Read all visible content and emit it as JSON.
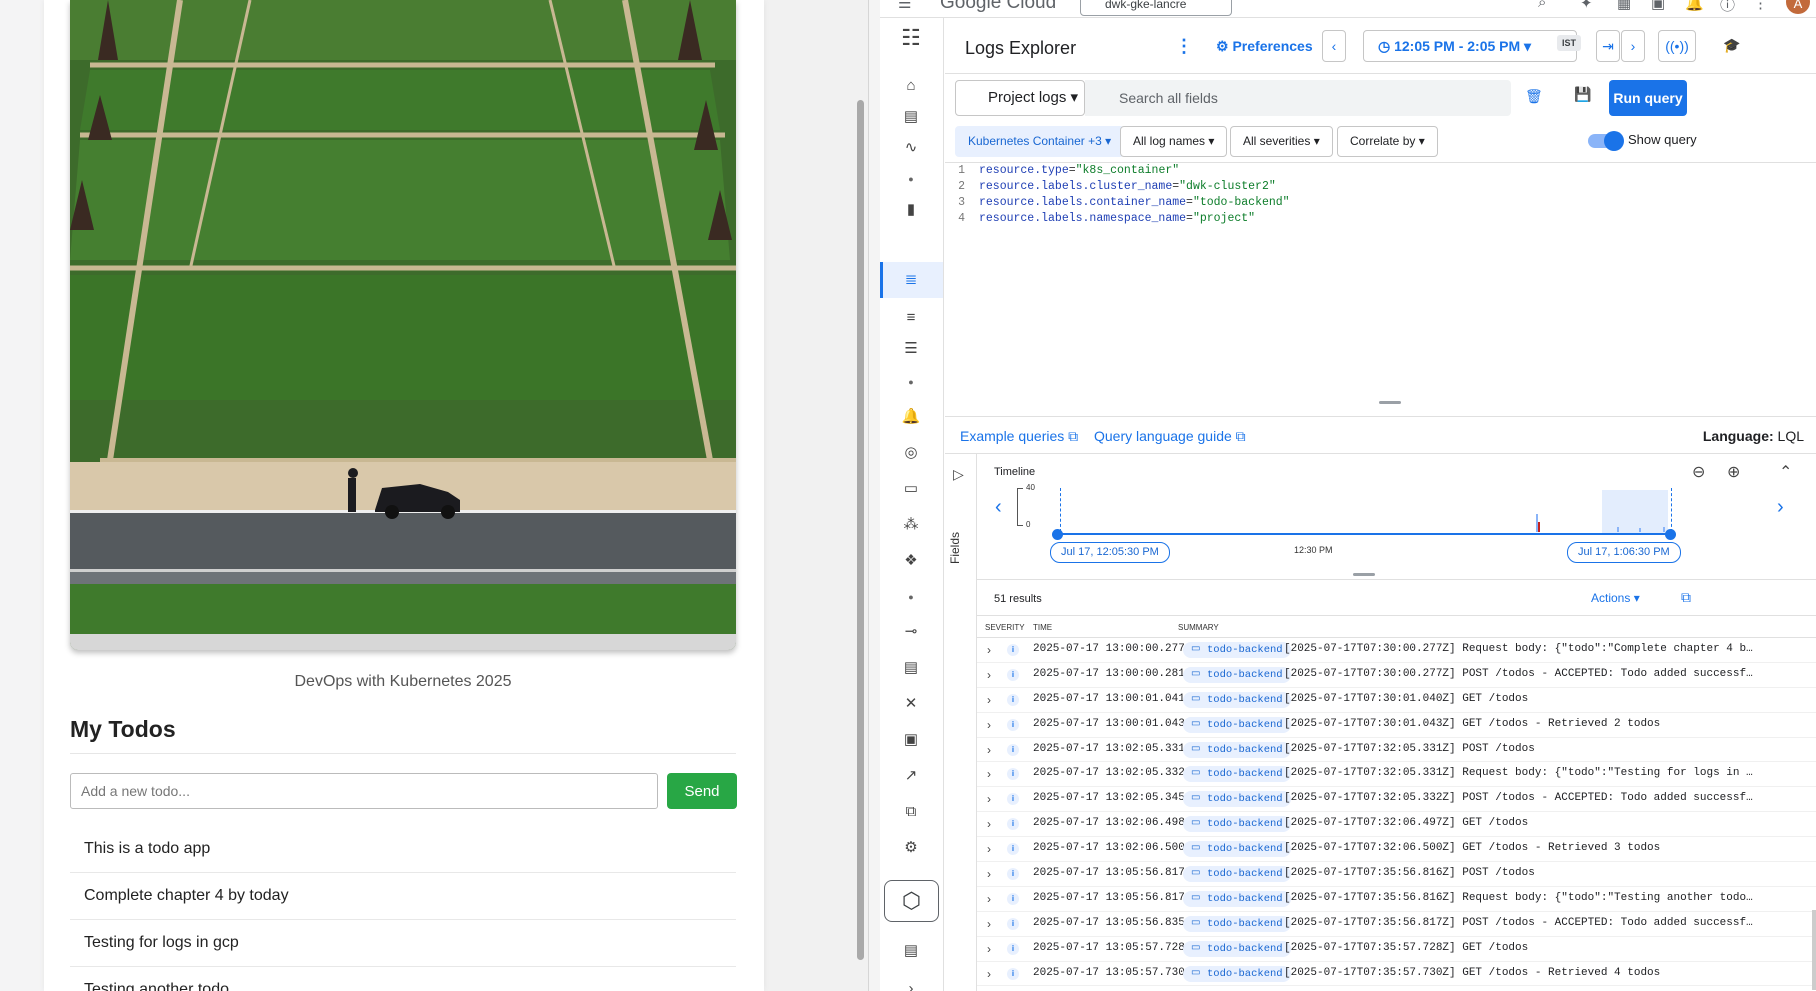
{
  "left_app": {
    "caption": "DevOps with Kubernetes 2025",
    "title": "My Todos",
    "input_placeholder": "Add a new todo...",
    "send_label": "Send",
    "todos": [
      "This is a todo app",
      "Complete chapter 4 by today",
      "Testing for logs in gcp",
      "Testing another todo"
    ]
  },
  "gcp": {
    "brand": "Google Cloud",
    "project": "dwk-gke-lancre",
    "avatar": "A",
    "page_title": "Logs Explorer",
    "preferences": "Preferences",
    "time_range": "12:05 PM - 2:05 PM",
    "timezone": "IST",
    "source_button": "Project logs",
    "search_placeholder": "Search all fields",
    "run_query": "Run query",
    "chips": [
      "Kubernetes Container +3",
      "All log names",
      "All severities",
      "Correlate by"
    ],
    "show_query": "Show query",
    "query_lines": [
      {
        "num": "1",
        "key": "resource.type",
        "value": "\"k8s_container\""
      },
      {
        "num": "2",
        "key": "resource.labels.cluster_name",
        "value": "\"dwk-cluster2\""
      },
      {
        "num": "3",
        "key": "resource.labels.container_name",
        "value": "\"todo-backend\""
      },
      {
        "num": "4",
        "key": "resource.labels.namespace_name",
        "value": "\"project\""
      }
    ],
    "example_queries": "Example queries",
    "query_guide": "Query language guide",
    "language_label": "Language:",
    "language_value": "LQL",
    "fields_label": "Fields",
    "timeline": {
      "title": "Timeline",
      "ymax": "40",
      "ymin": "0",
      "start": "Jul 17, 12:05:30 PM",
      "mid": "12:30 PM",
      "end": "Jul 17, 1:06:30 PM"
    },
    "results_count": "51 results",
    "actions": "Actions",
    "columns": [
      "SEVERITY",
      "TIME",
      "SUMMARY"
    ],
    "rows": [
      {
        "time": "2025-07-17 13:00:00.277",
        "resource": "todo-backend",
        "summary": "[2025-07-17T07:30:00.277Z] Request body: {\"todo\":\"Complete chapter 4 b…"
      },
      {
        "time": "2025-07-17 13:00:00.281",
        "resource": "todo-backend",
        "summary": "[2025-07-17T07:30:00.277Z] POST /todos - ACCEPTED: Todo added successf…"
      },
      {
        "time": "2025-07-17 13:00:01.041",
        "resource": "todo-backend",
        "summary": "[2025-07-17T07:30:01.040Z] GET /todos"
      },
      {
        "time": "2025-07-17 13:00:01.043",
        "resource": "todo-backend",
        "summary": "[2025-07-17T07:30:01.043Z] GET /todos - Retrieved 2 todos"
      },
      {
        "time": "2025-07-17 13:02:05.331",
        "resource": "todo-backend",
        "summary": "[2025-07-17T07:32:05.331Z] POST /todos"
      },
      {
        "time": "2025-07-17 13:02:05.332",
        "resource": "todo-backend",
        "summary": "[2025-07-17T07:32:05.331Z] Request body: {\"todo\":\"Testing for logs in …"
      },
      {
        "time": "2025-07-17 13:02:05.345",
        "resource": "todo-backend",
        "summary": "[2025-07-17T07:32:05.332Z] POST /todos - ACCEPTED: Todo added successf…"
      },
      {
        "time": "2025-07-17 13:02:06.498",
        "resource": "todo-backend",
        "summary": "[2025-07-17T07:32:06.497Z] GET /todos"
      },
      {
        "time": "2025-07-17 13:02:06.500",
        "resource": "todo-backend",
        "summary": "[2025-07-17T07:32:06.500Z] GET /todos - Retrieved 3 todos"
      },
      {
        "time": "2025-07-17 13:05:56.817",
        "resource": "todo-backend",
        "summary": "[2025-07-17T07:35:56.816Z] POST /todos"
      },
      {
        "time": "2025-07-17 13:05:56.817",
        "resource": "todo-backend",
        "summary": "[2025-07-17T07:35:56.816Z] Request body: {\"todo\":\"Testing another todo…"
      },
      {
        "time": "2025-07-17 13:05:56.835",
        "resource": "todo-backend",
        "summary": "[2025-07-17T07:35:56.817Z] POST /todos - ACCEPTED: Todo added successf…"
      },
      {
        "time": "2025-07-17 13:05:57.728",
        "resource": "todo-backend",
        "summary": "[2025-07-17T07:35:57.728Z] GET /todos"
      },
      {
        "time": "2025-07-17 13:05:57.730",
        "resource": "todo-backend",
        "summary": "[2025-07-17T07:35:57.730Z] GET /todos - Retrieved 4 todos"
      }
    ]
  }
}
